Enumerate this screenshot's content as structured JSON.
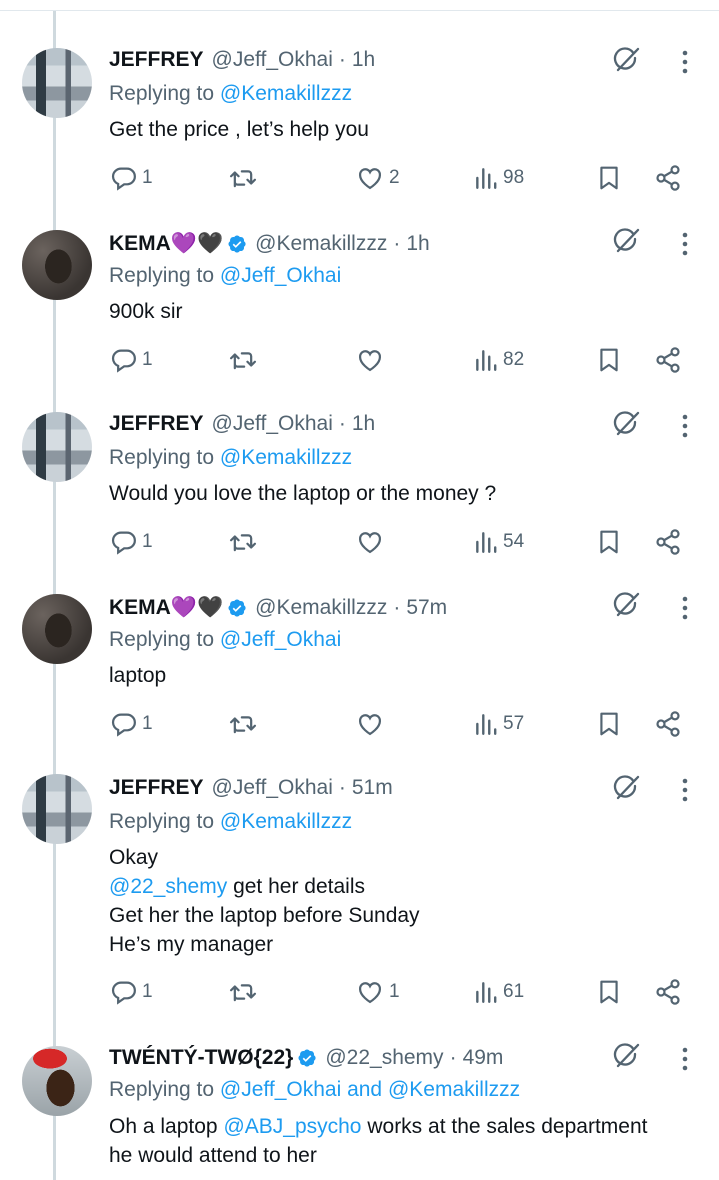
{
  "colors": {
    "link": "#1d9bf0",
    "muted": "#536471",
    "text": "#0f1419",
    "thread_line": "#cfd9de"
  },
  "replying_prefix": "Replying to",
  "tweets": [
    {
      "name": "JEFFREY",
      "handle": "@Jeff_Okhai",
      "time": "1h",
      "replying_to": "@Kemakillzzz",
      "lines": [
        "Get the price , let’s help you"
      ],
      "stats": {
        "replies": "1",
        "retweets": "",
        "likes": "2",
        "views": "98"
      }
    },
    {
      "name": "KEMA💜🖤",
      "handle": "@Kemakillzzz",
      "time": "1h",
      "replying_to": "@Jeff_Okhai",
      "lines": [
        "900k sir"
      ],
      "stats": {
        "replies": "1",
        "retweets": "",
        "likes": "",
        "views": "82"
      }
    },
    {
      "name": "JEFFREY",
      "handle": "@Jeff_Okhai",
      "time": "1h",
      "replying_to": "@Kemakillzzz",
      "lines": [
        "Would you love the laptop or the money ?"
      ],
      "stats": {
        "replies": "1",
        "retweets": "",
        "likes": "",
        "views": "54"
      }
    },
    {
      "name": "KEMA💜🖤",
      "handle": "@Kemakillzzz",
      "time": "57m",
      "replying_to": "@Jeff_Okhai",
      "lines": [
        "laptop"
      ],
      "stats": {
        "replies": "1",
        "retweets": "",
        "likes": "",
        "views": "57"
      }
    },
    {
      "name": "JEFFREY",
      "handle": "@Jeff_Okhai",
      "time": "51m",
      "replying_to": "@Kemakillzzz",
      "lines": [
        "Okay",
        "get her details",
        "Get her the laptop before Sunday",
        "He’s my manager"
      ],
      "mention": "@22_shemy",
      "stats": {
        "replies": "1",
        "retweets": "",
        "likes": "1",
        "views": "61"
      }
    },
    {
      "name": "TWÉNTÝ-TWØ{22}",
      "handle": "@22_shemy",
      "time": "49m",
      "replying_to_a": "@Jeff_Okhai",
      "replying_and": "and",
      "replying_to_b": "@Kemakillzzz",
      "line1_start": "Oh a laptop",
      "line1_mention": "@ABJ_psycho",
      "line1_end": "works at the sales department",
      "line2": "he would attend to her"
    }
  ]
}
